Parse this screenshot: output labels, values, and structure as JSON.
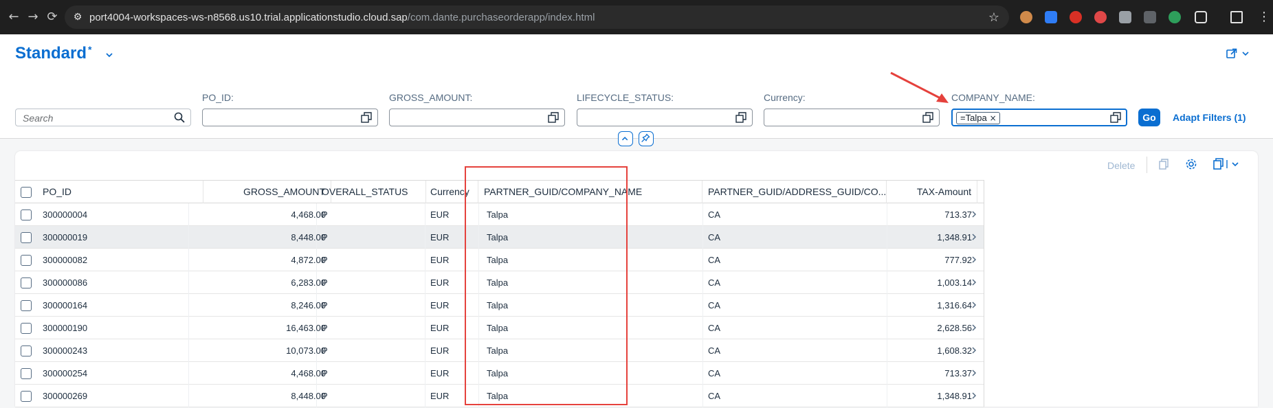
{
  "browser": {
    "url_host": "port4004-workspaces-ws-n8568.us10.trial.applicationstudio.cloud.sap",
    "url_path": "/com.dante.purchaseorderapp/index.html",
    "icons": [
      "back-icon",
      "forward-icon",
      "reload-icon",
      "site-info-icon",
      "bookmark-star-icon"
    ]
  },
  "header": {
    "variant_name": "Standard",
    "variant_modified": "*"
  },
  "filters": {
    "search_placeholder": "Search",
    "labels": {
      "po_id": "PO_ID:",
      "gross_amount": "GROSS_AMOUNT:",
      "lifecycle_status": "LIFECYCLE_STATUS:",
      "currency": "Currency:",
      "company_name": "COMPANY_NAME:"
    },
    "company_token": "=Talpa",
    "go_label": "Go",
    "adapt_label": "Adapt Filters (1)"
  },
  "toolbar": {
    "delete_label": "Delete"
  },
  "table": {
    "columns": [
      "PO_ID",
      "GROSS_AMOUNT",
      "OVERALL_STATUS",
      "Currency",
      "PARTNER_GUID/COMPANY_NAME",
      "PARTNER_GUID/ADDRESS_GUID/CO...",
      "TAX-Amount"
    ],
    "rows": [
      [
        "300000004",
        "4,468.00",
        "P",
        "EUR",
        "Talpa",
        "CA",
        "713.37"
      ],
      [
        "300000019",
        "8,448.00",
        "P",
        "EUR",
        "Talpa",
        "CA",
        "1,348.91"
      ],
      [
        "300000082",
        "4,872.00",
        "P",
        "EUR",
        "Talpa",
        "CA",
        "777.92"
      ],
      [
        "300000086",
        "6,283.00",
        "P",
        "EUR",
        "Talpa",
        "CA",
        "1,003.14"
      ],
      [
        "300000164",
        "8,246.00",
        "P",
        "EUR",
        "Talpa",
        "CA",
        "1,316.64"
      ],
      [
        "300000190",
        "16,463.00",
        "P",
        "EUR",
        "Talpa",
        "CA",
        "2,628.56"
      ],
      [
        "300000243",
        "10,073.00",
        "P",
        "EUR",
        "Talpa",
        "CA",
        "1,608.32"
      ],
      [
        "300000254",
        "4,468.00",
        "P",
        "EUR",
        "Talpa",
        "CA",
        "713.37"
      ],
      [
        "300000269",
        "8,448.00",
        "P",
        "EUR",
        "Talpa",
        "CA",
        "1,348.91"
      ]
    ]
  },
  "colors": {
    "accent": "#0a6ed1",
    "annotation": "#e5413c"
  }
}
